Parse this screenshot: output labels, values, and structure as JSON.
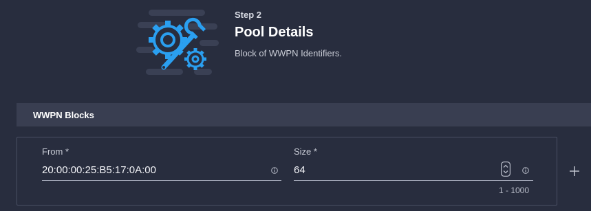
{
  "step": {
    "label": "Step 2",
    "title": "Pool Details",
    "description": "Block of WWPN Identifiers."
  },
  "section": {
    "title": "WWPN Blocks"
  },
  "block": {
    "from": {
      "label": "From *",
      "value": "20:00:00:25:B5:17:0A:00"
    },
    "size": {
      "label": "Size *",
      "value": "64",
      "range_hint": "1 - 1000"
    }
  },
  "icons": {
    "illustration": "gears-wrench-icon",
    "info": "info-icon",
    "stepper": "stepper-icon",
    "add": "plus-icon"
  },
  "colors": {
    "background": "#282d3e",
    "section_header": "#393e51",
    "accent": "#2a9ff0"
  }
}
